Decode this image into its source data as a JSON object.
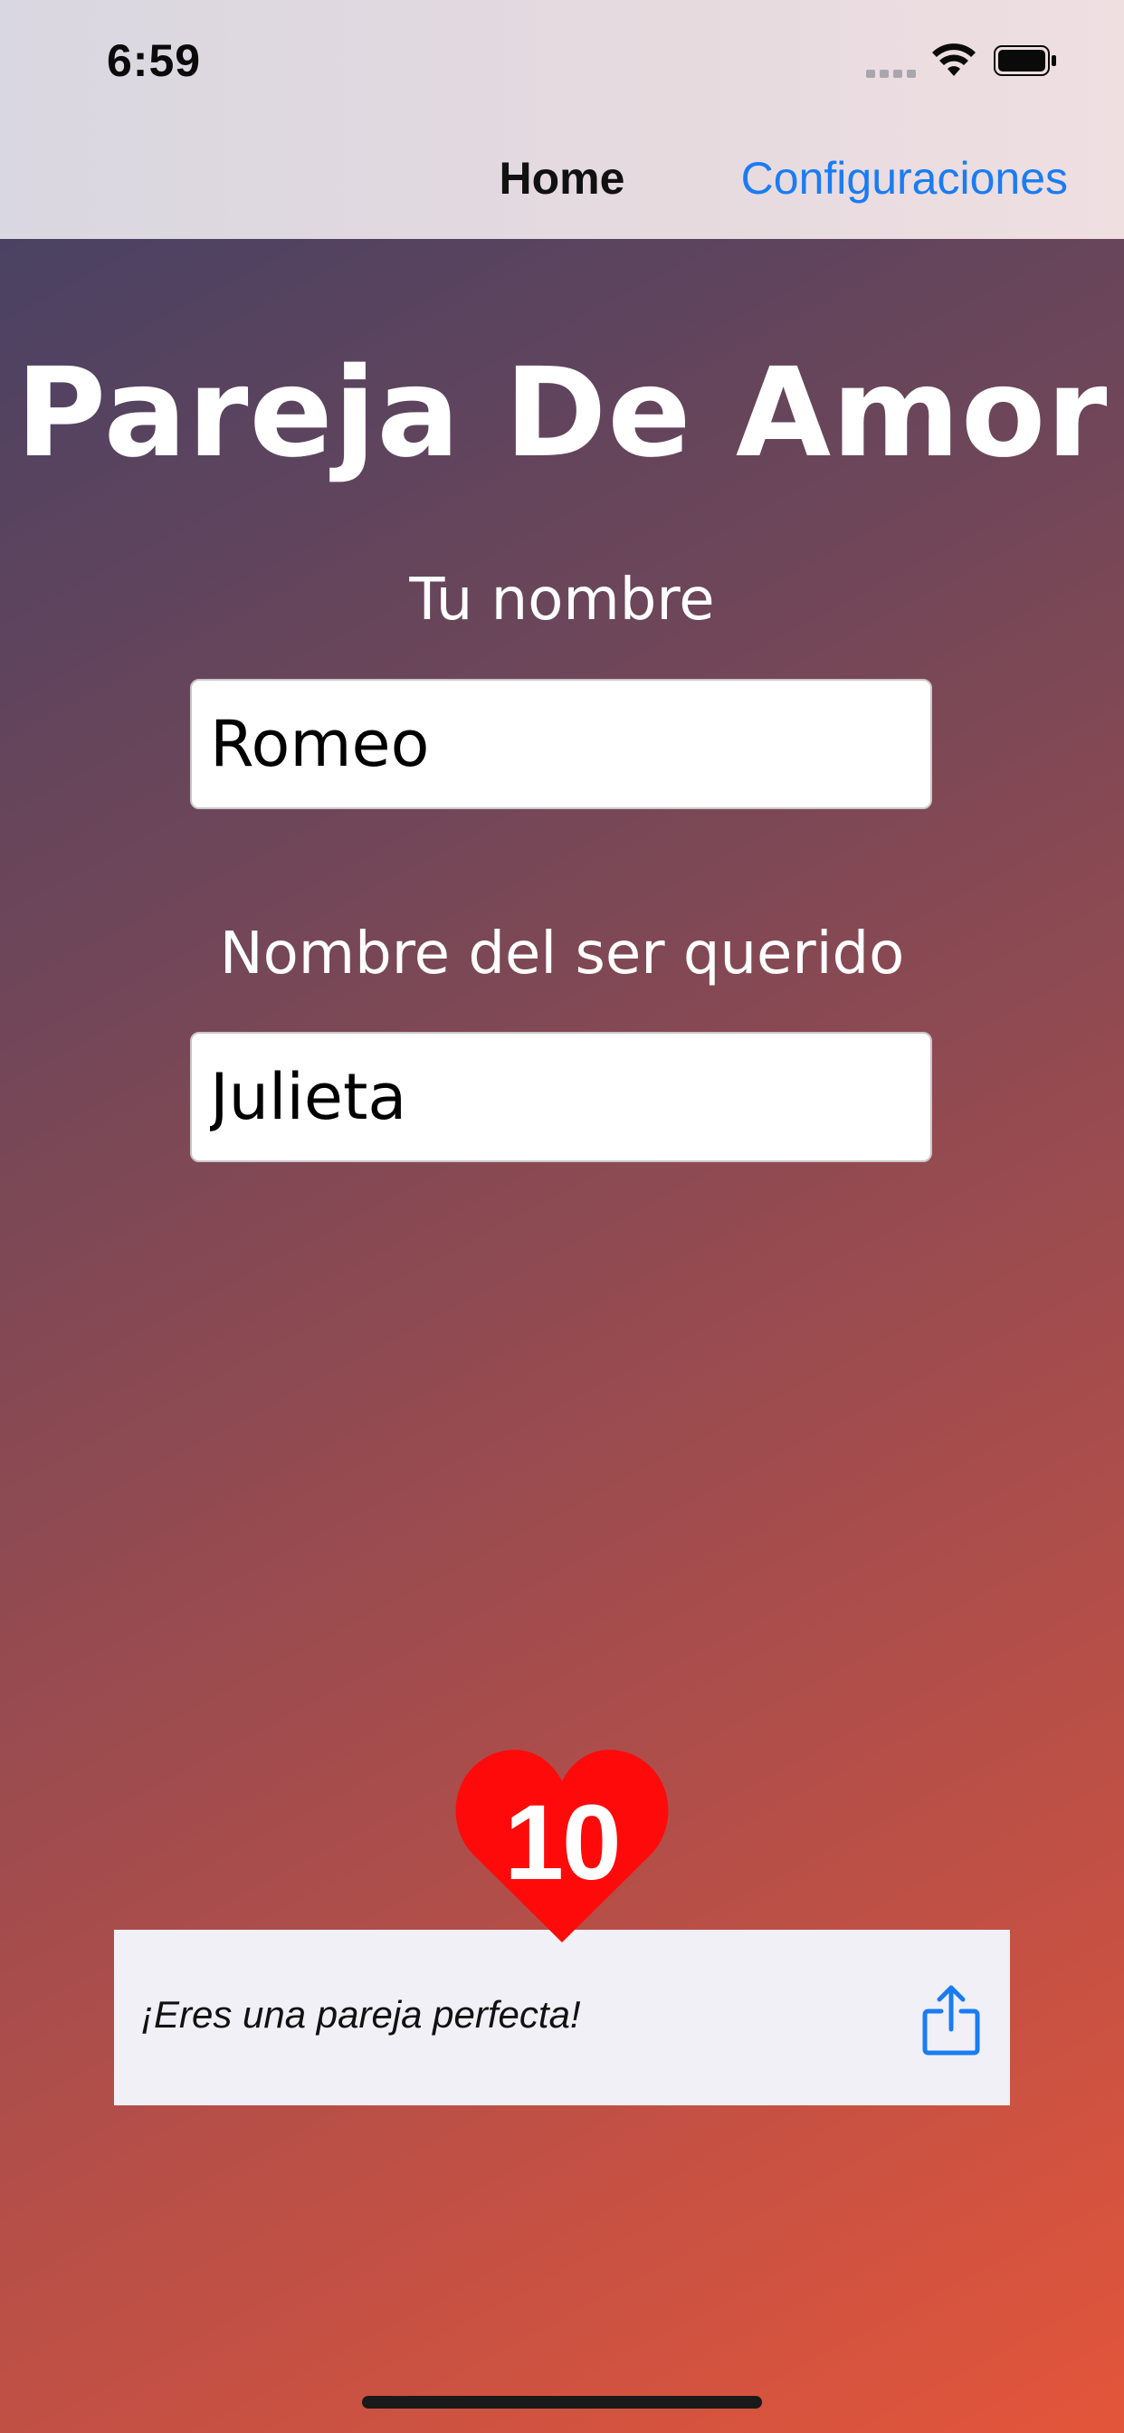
{
  "status_bar": {
    "time": "6:59"
  },
  "nav": {
    "title": "Home",
    "right_button": "Configuraciones"
  },
  "app": {
    "title": "Pareja De Amor",
    "your_name_label": "Tu nombre",
    "your_name_value": "Romeo",
    "loved_one_label": "Nombre del ser querido",
    "loved_one_value": "Julieta"
  },
  "result": {
    "score": "10",
    "message": "¡Eres una pareja perfecta!"
  },
  "colors": {
    "accent": "#1a7cf3",
    "heart": "#ff0a0a",
    "card": "#f1f0f6"
  },
  "icons": {
    "share": "share-icon",
    "heart": "heart-icon",
    "wifi": "wifi-icon",
    "battery": "battery-icon",
    "signal": "signal-icon"
  }
}
